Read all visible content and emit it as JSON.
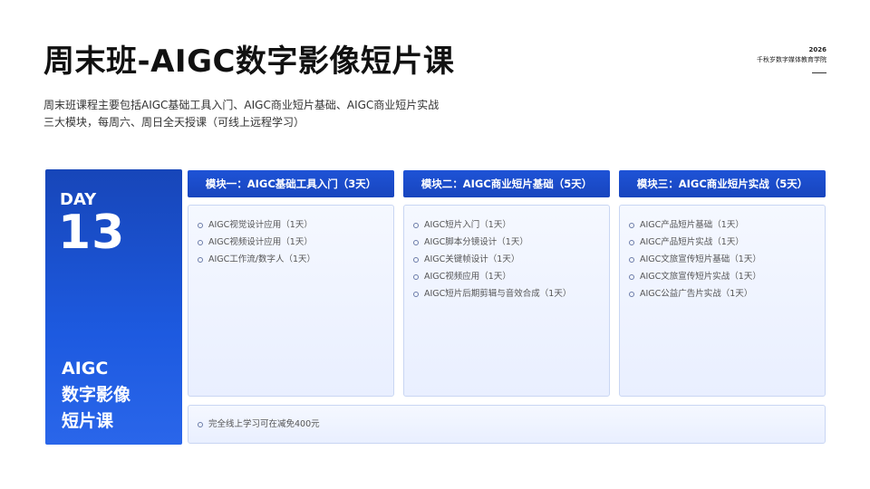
{
  "title": "周末班-AIGC数字影像短片课",
  "brand": {
    "year": "2026",
    "name": "千秋岁数字媒体教育学院"
  },
  "description": "周末班课程主要包括AIGC基础工具入门、AIGC商业短片基础、AIGC商业短片实战三大模块，每周六、周日全天授课（可线上远程学习）",
  "day_card": {
    "label": "DAY",
    "number": "13",
    "subtitle": [
      "AIGC",
      "数字影像",
      "短片课"
    ]
  },
  "modules": [
    {
      "header": "模块一：AIGC基础工具入门（3天）",
      "items": [
        "AIGC视觉设计应用（1天）",
        "AIGC视频设计应用（1天）",
        "AIGC工作流/数字人（1天）"
      ]
    },
    {
      "header": "模块二：AIGC商业短片基础（5天）",
      "items": [
        "AIGC短片入门（1天）",
        "AIGC脚本分镜设计（1天）",
        "AIGC关键帧设计（1天）",
        "AIGC视频应用（1天）",
        "AIGC短片后期剪辑与音效合成（1天）"
      ]
    },
    {
      "header": "模块三：AIGC商业短片实战（5天）",
      "items": [
        "AIGC产品短片基础（1天）",
        "AIGC产品短片实战（1天）",
        "AIGC文旅宣传短片基础（1天）",
        "AIGC文旅宣传短片实战（1天）",
        "AIGC公益广告片实战（1天）"
      ]
    }
  ],
  "footer_note": "完全线上学习可在减免400元",
  "colors": {
    "accent": "#1d4fd0",
    "panel_bg": "#eef3ff",
    "panel_border": "#c9d6f3"
  }
}
